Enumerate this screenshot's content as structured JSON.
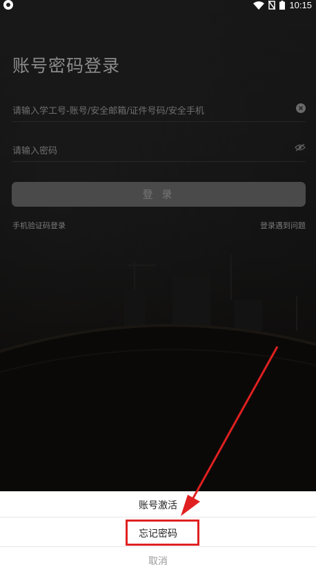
{
  "status_bar": {
    "time": "10:15",
    "icons": [
      "wifi-icon",
      "no-sim-icon",
      "battery-icon"
    ]
  },
  "login": {
    "title": "账号密码登录",
    "account_placeholder": "请输入学工号-账号/安全邮箱/证件号码/安全手机",
    "password_placeholder": "请输入密码",
    "login_button": "登 录",
    "sms_login_link": "手机验证码登录",
    "problem_link": "登录遇到问题"
  },
  "action_sheet": {
    "items": [
      "账号激活",
      "忘记密码"
    ],
    "cancel": "取消"
  },
  "colors": {
    "annotation_red": "#e02020"
  }
}
